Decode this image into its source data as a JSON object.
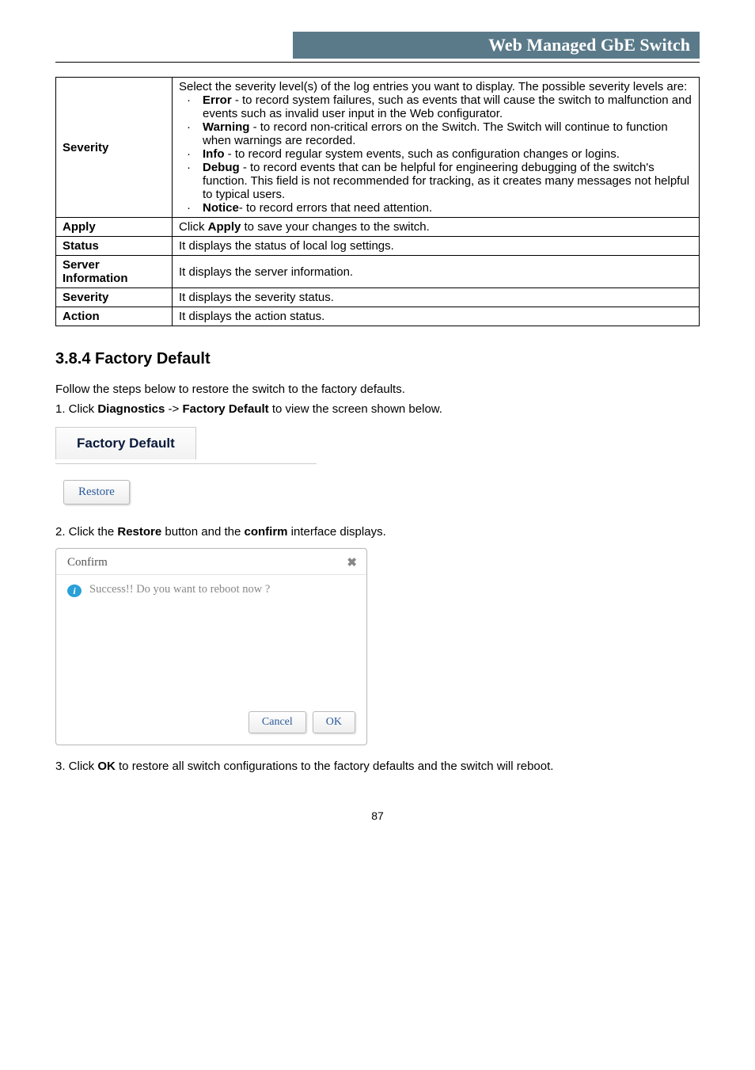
{
  "header": {
    "title": "Web Managed GbE Switch"
  },
  "table": {
    "rows": {
      "severity": {
        "label": "Severity",
        "intro": "Select the severity level(s) of the log entries you want to display. The possible severity levels are:",
        "items": [
          {
            "term": "Error",
            "rest": " - to record system failures, such as events that will cause the switch to malfunction and events such as invalid user input in the Web configurator."
          },
          {
            "term": "Warning",
            "rest": " - to record non-critical errors on the Switch. The Switch will continue to function when warnings are recorded."
          },
          {
            "term": "Info",
            "rest": " - to record regular system events, such as configuration changes or logins."
          },
          {
            "term": "Debug",
            "rest": " - to record events that can be helpful for engineering debugging of the switch's function. This field is not recommended for tracking, as it creates many messages not helpful to typical users."
          },
          {
            "term": "Notice",
            "rest": "- to record errors that need attention."
          }
        ]
      },
      "apply": {
        "label": "Apply",
        "pre": "Click ",
        "bold": "Apply",
        "post": " to save your changes to the switch."
      },
      "status": {
        "label": "Status",
        "desc": "It displays the status of local log settings."
      },
      "server": {
        "label1": "Server",
        "label2": "Information",
        "desc": "It displays the server information."
      },
      "severity2": {
        "label": "Severity",
        "desc": "It displays the severity status."
      },
      "action": {
        "label": "Action",
        "desc": "It displays the action status."
      }
    }
  },
  "section": {
    "heading": "3.8.4 Factory Default",
    "p1": "Follow the steps below to restore the switch to the factory defaults.",
    "p2_pre": "1. Click ",
    "p2_b1": "Diagnostics",
    "p2_mid": " -> ",
    "p2_b2": "Factory Default",
    "p2_post": " to view the screen shown below.",
    "tab_label": "Factory Default",
    "restore_btn": "Restore",
    "p3_pre": "2. Click the ",
    "p3_b1": "Restore",
    "p3_mid": " button and the ",
    "p3_b2": "confirm",
    "p3_post": " interface displays.",
    "dialog": {
      "title": "Confirm",
      "close": "✖",
      "icon": "i",
      "message": "Success!! Do you want to reboot now ?",
      "cancel": "Cancel",
      "ok": "OK"
    },
    "p4_pre": "3. Click ",
    "p4_b1": "OK",
    "p4_post": " to restore all switch configurations to the factory defaults and the switch will reboot."
  },
  "page_number": "87"
}
